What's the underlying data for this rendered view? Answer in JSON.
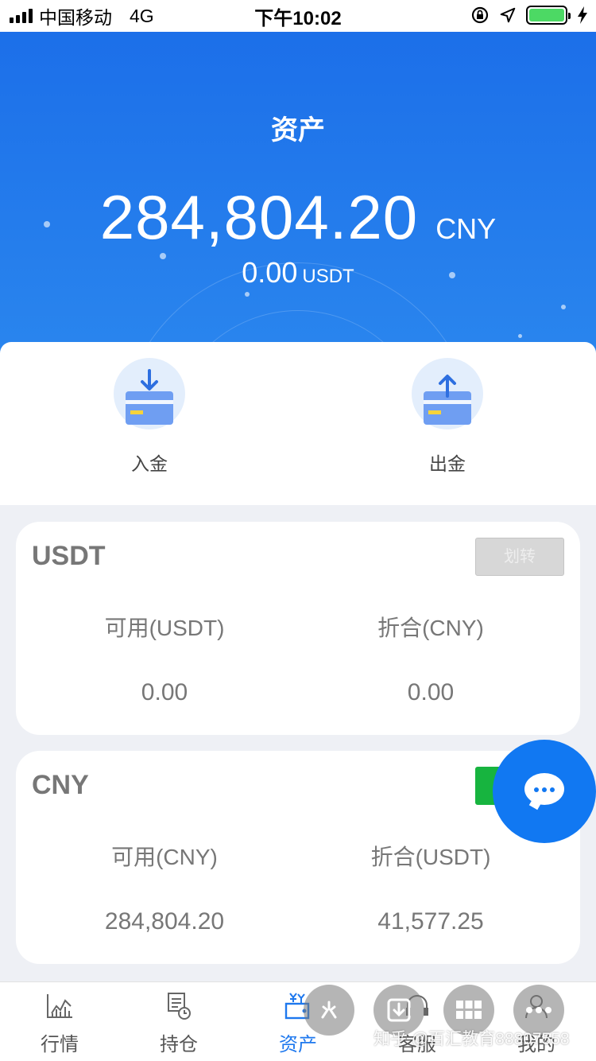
{
  "status_bar": {
    "carrier": "中国移动",
    "network": "4G",
    "time": "下午10:02"
  },
  "header": {
    "title": "资产",
    "total_amount": "284,804.20",
    "total_currency": "CNY",
    "sub_amount": "0.00",
    "sub_currency": "USDT"
  },
  "actions": [
    {
      "label": "入金",
      "icon": "deposit-icon"
    },
    {
      "label": "出金",
      "icon": "withdraw-icon"
    }
  ],
  "accounts": [
    {
      "name": "USDT",
      "button_label": "划转",
      "available_label": "可用(USDT)",
      "available_value": "0.00",
      "converted_label": "折合(CNY)",
      "converted_value": "0.00"
    },
    {
      "name": "CNY",
      "button_label": "",
      "available_label": "可用(CNY)",
      "available_value": "284,804.20",
      "converted_label": "折合(USDT)",
      "converted_value": "41,577.25"
    }
  ],
  "tabs": [
    {
      "label": "行情",
      "icon": "chart-icon",
      "active": false
    },
    {
      "label": "持仓",
      "icon": "document-clock-icon",
      "active": false
    },
    {
      "label": "资产",
      "icon": "wallet-icon",
      "active": true
    },
    {
      "label": "客服",
      "icon": "headset-icon",
      "active": false
    },
    {
      "label": "我的",
      "icon": "user-icon",
      "active": false
    }
  ],
  "watermark": "知乎 @百汇教育88807558",
  "colors": {
    "primary": "#1c6fe9",
    "active_tab": "#1e78ee",
    "green_button": "#17b43f",
    "fab": "#1178f2"
  }
}
